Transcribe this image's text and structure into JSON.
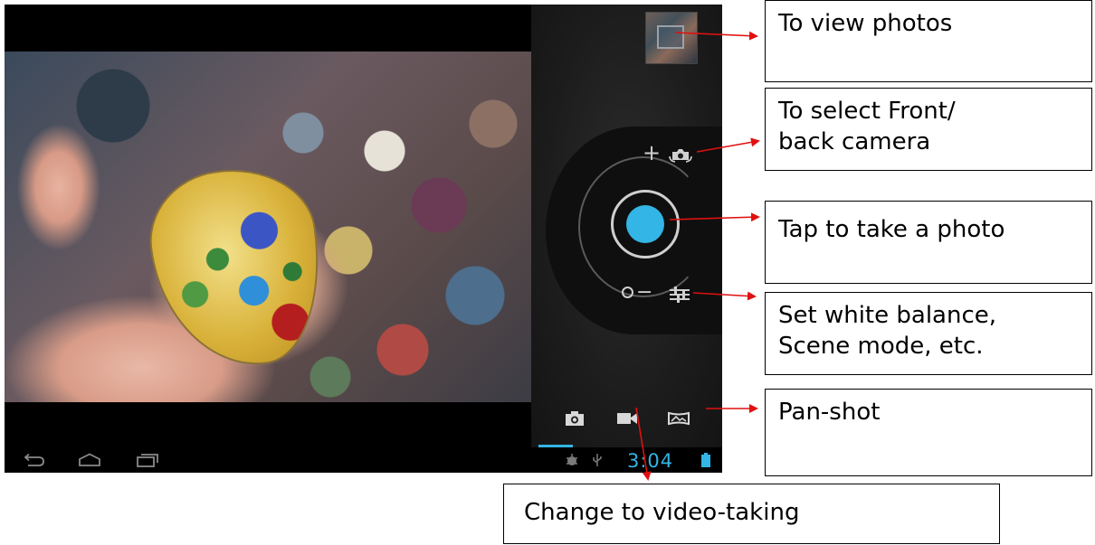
{
  "screen": {
    "status_bar": {
      "time": "3:04",
      "icons": [
        "debug-icon",
        "usb-icon",
        "battery-icon"
      ]
    },
    "navigation": [
      "back-icon",
      "home-icon",
      "recents-icon"
    ],
    "camera_controls": {
      "zoom_plus": "+",
      "zoom_minus": "−",
      "switch_camera_icon": "switch-camera-icon",
      "settings_icon": "settings-sliders-icon",
      "modes": [
        "photo-camera-icon",
        "video-camera-icon",
        "panorama-icon"
      ],
      "selected_mode": "photo"
    }
  },
  "callouts": {
    "view_photos": "To view photos",
    "front_back_line1": "To select Front/",
    "front_back_line2": "back camera",
    "tap_photo": "Tap to take a photo",
    "white_balance_line1": "Set white balance,",
    "white_balance_line2": "Scene mode, etc.",
    "pan_shot": "Pan-shot",
    "video": "Change to video-taking"
  },
  "colors": {
    "accent": "#33b5e5",
    "arrow": "#e01010"
  }
}
